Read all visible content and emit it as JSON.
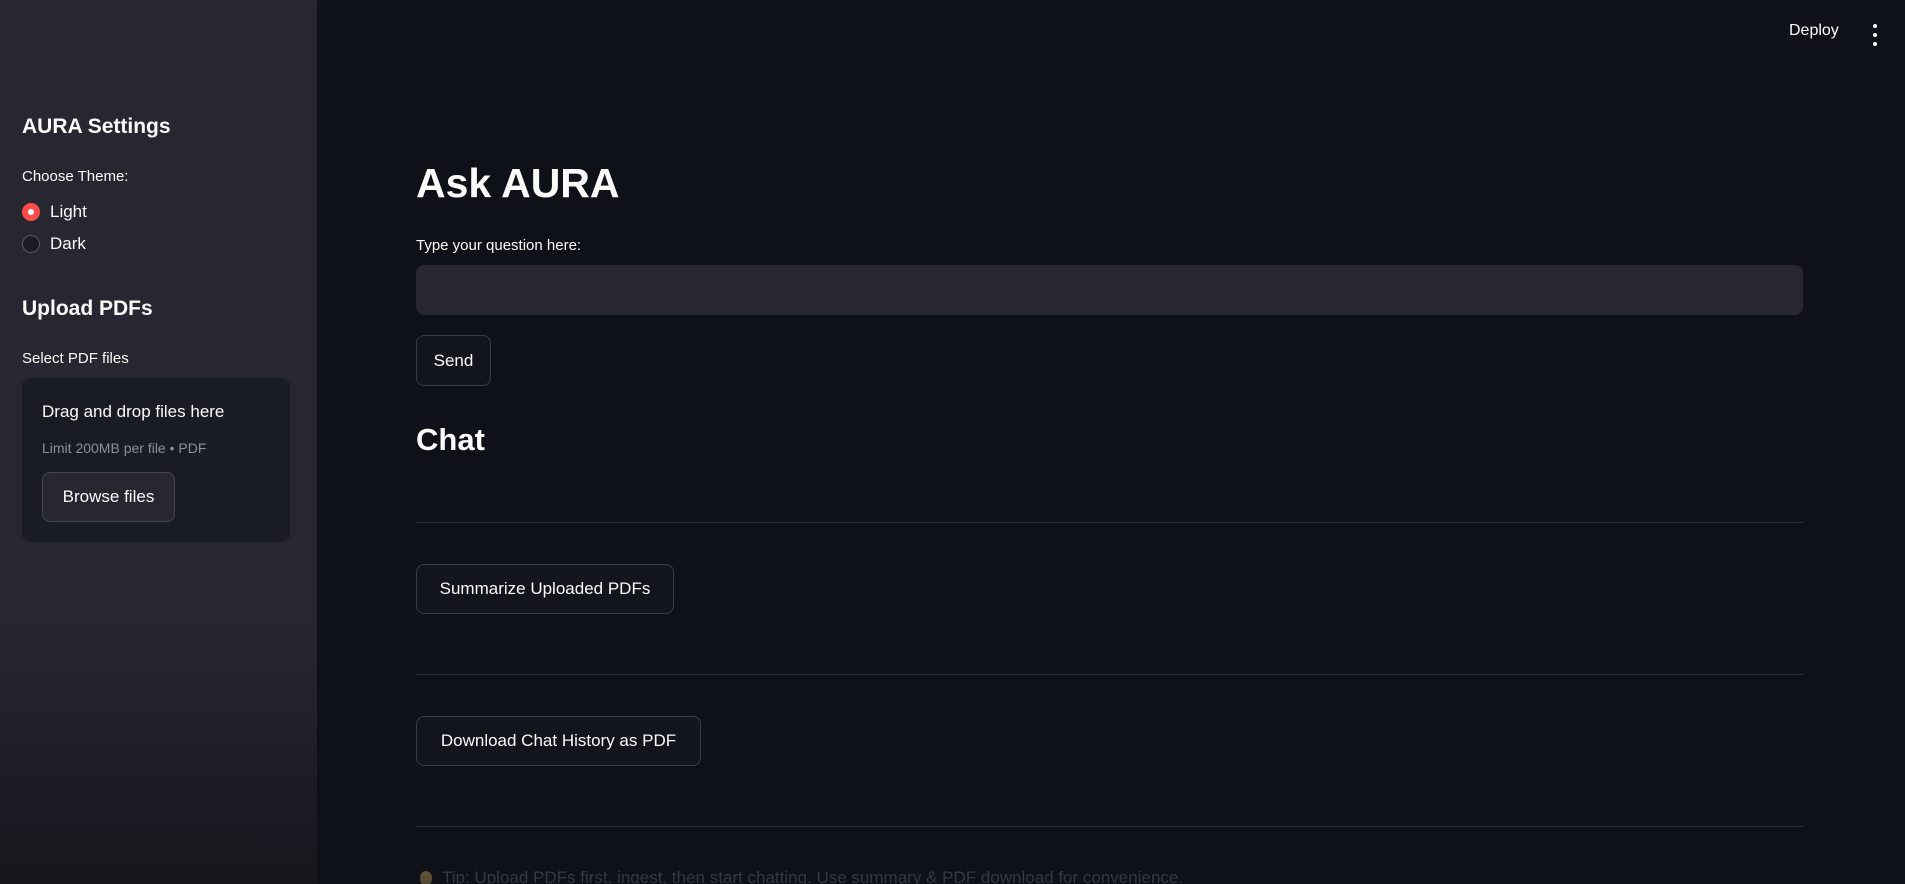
{
  "header": {
    "deploy_label": "Deploy",
    "menu_icon": "kebab-menu-icon"
  },
  "sidebar": {
    "settings_heading": "AURA Settings",
    "theme_label": "Choose Theme:",
    "theme_options": [
      {
        "label": "Light",
        "selected": true
      },
      {
        "label": "Dark",
        "selected": false
      }
    ],
    "upload_heading": "Upload PDFs",
    "select_label": "Select PDF files",
    "dropzone": {
      "title": "Drag and drop files here",
      "limit": "Limit 200MB per file • PDF",
      "browse_label": "Browse files"
    }
  },
  "main": {
    "title": "Ask AURA",
    "question_label": "Type your question here:",
    "question_value": "",
    "send_label": "Send",
    "chat_heading": "Chat",
    "summarize_label": "Summarize Uploaded PDFs",
    "download_label": "Download Chat History as PDF",
    "tip_text": "Tip: Upload PDFs first, ingest, then start chatting. Use summary & PDF download for convenience."
  },
  "colors": {
    "accent": "#ff4b4b",
    "background": "#0e1117",
    "sidebar": "#262730"
  }
}
